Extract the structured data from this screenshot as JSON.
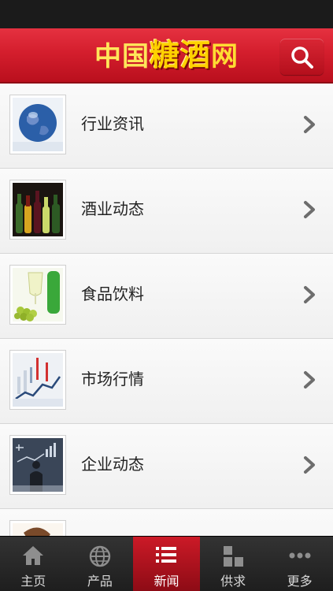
{
  "header": {
    "logo_part1": "中国",
    "logo_part2": "糖酒",
    "logo_part3": "网"
  },
  "icons": {
    "search": "search-icon",
    "chevron": "chevron-right-icon",
    "tabs": [
      "home-icon",
      "globe-icon",
      "list-icon",
      "grid-icon",
      "more-icon"
    ]
  },
  "list": {
    "items": [
      {
        "label": "行业资讯",
        "thumb": "globe-image"
      },
      {
        "label": "酒业动态",
        "thumb": "wine-bottles-image"
      },
      {
        "label": "食品饮料",
        "thumb": "grapes-drink-image"
      },
      {
        "label": "市场行情",
        "thumb": "market-chart-image"
      },
      {
        "label": "企业动态",
        "thumb": "businessman-image"
      },
      {
        "label": "",
        "thumb": "teapot-image"
      }
    ]
  },
  "tabbar": {
    "tabs": [
      {
        "label": "主页",
        "active": false
      },
      {
        "label": "产品",
        "active": false
      },
      {
        "label": "新闻",
        "active": true
      },
      {
        "label": "供求",
        "active": false
      },
      {
        "label": "更多",
        "active": false
      }
    ]
  },
  "colors": {
    "header_red": "#d41e2d",
    "logo_yellow": "#ffd100",
    "tab_active": "#cc1a27",
    "tabbar_bg": "#2a2a2a"
  }
}
